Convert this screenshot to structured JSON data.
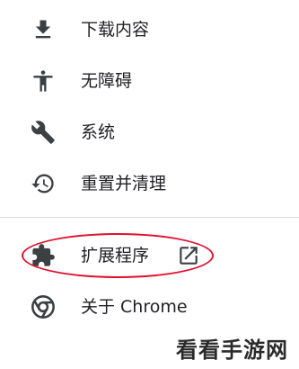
{
  "menu": {
    "items": [
      {
        "label": "下载内容",
        "icon": "download-icon"
      },
      {
        "label": "无障碍",
        "icon": "accessibility-icon"
      },
      {
        "label": "系统",
        "icon": "wrench-icon"
      },
      {
        "label": "重置并清理",
        "icon": "restore-history-icon"
      },
      {
        "label": "扩展程序",
        "icon": "puzzle-icon",
        "trailing_icon": "open-in-new-icon"
      },
      {
        "label": "关于 Chrome",
        "icon": "chrome-logo-icon"
      }
    ]
  },
  "annotation": {
    "highlight_color": "#e0102b",
    "highlighted_item": "扩展程序"
  },
  "watermark": {
    "text": "看看手游网"
  },
  "colors": {
    "icon": "#3c4043",
    "text": "#202124",
    "divider": "#dadce0"
  }
}
